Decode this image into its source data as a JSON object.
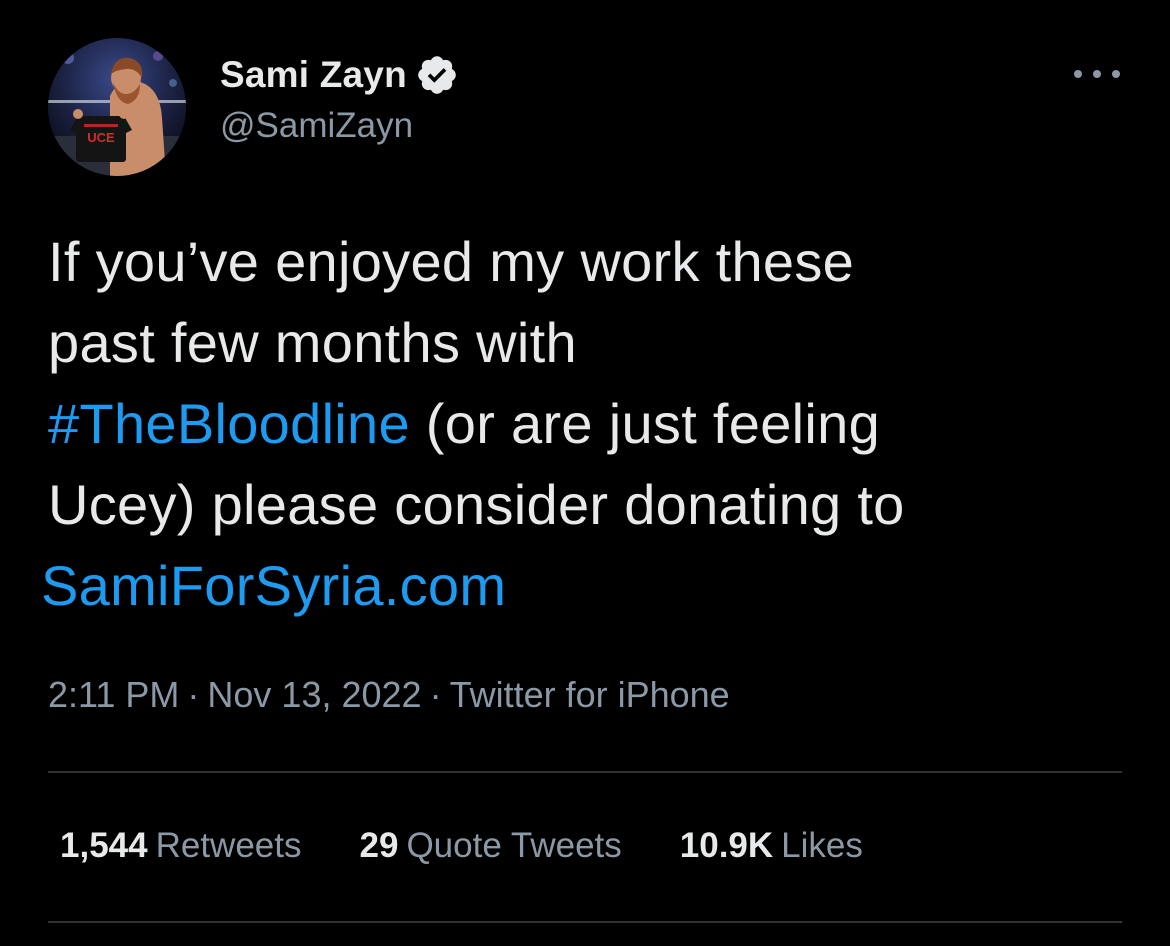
{
  "author": {
    "display_name": "Sami Zayn",
    "handle": "@SamiZayn",
    "verified_icon": "verified-badge-icon",
    "avatar_shirt_text": "UCE"
  },
  "tweet": {
    "text_line1": "If you’ve enjoyed my work these",
    "text_line2": "past few months with",
    "hashtag": "#TheBloodline",
    "text_line3_rest": " (or are just feeling",
    "text_line4": "Ucey) please consider donating to",
    "url": "SamiForSyria.com"
  },
  "meta": {
    "time": "2:11 PM",
    "separator": "·",
    "date": "Nov 13, 2022",
    "source": "Twitter for iPhone"
  },
  "stats": {
    "retweets_count": "1,544",
    "retweets_label": "Retweets",
    "quotes_count": "29",
    "quotes_label": "Quote Tweets",
    "likes_count": "10.9K",
    "likes_label": "Likes"
  },
  "colors": {
    "background": "#000000",
    "text_primary": "#e7e9ea",
    "text_secondary": "#8b98a5",
    "link": "#1d9bf0",
    "divider": "#2f3336"
  }
}
